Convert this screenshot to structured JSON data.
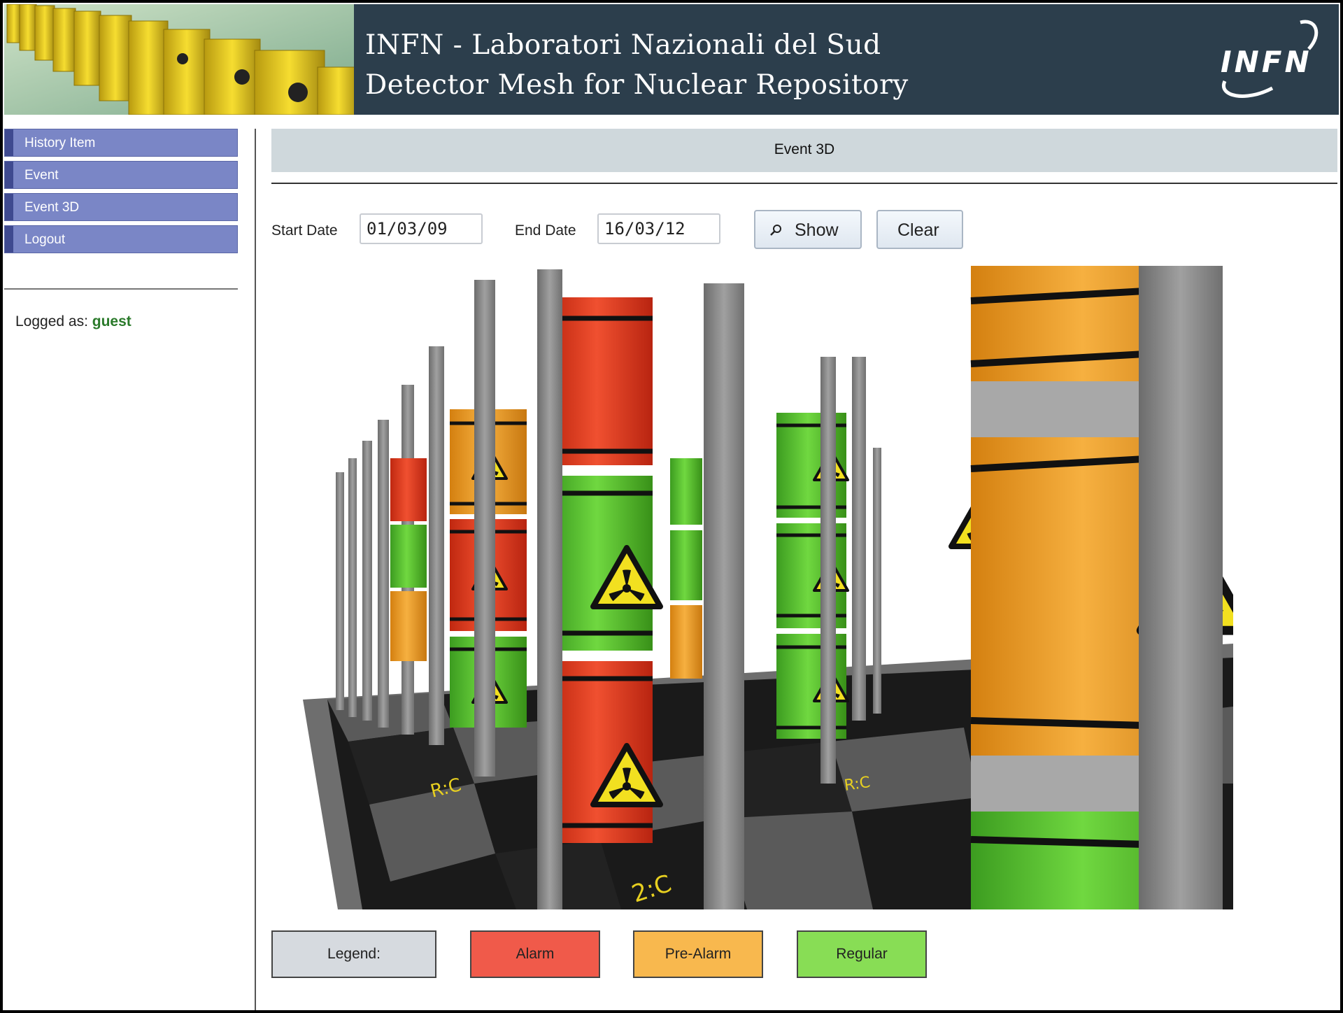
{
  "header": {
    "title_line1": "INFN - Laboratori Nazionali del Sud",
    "title_line2": "Detector Mesh for Nuclear Repository",
    "logo_text": "INFN"
  },
  "sidebar": {
    "items": [
      {
        "label": "History Item"
      },
      {
        "label": "Event"
      },
      {
        "label": "Event 3D"
      },
      {
        "label": "Logout"
      }
    ],
    "logged_label": "Logged as:",
    "logged_user": "guest"
  },
  "main": {
    "panel_title": "Event 3D",
    "start_date_label": "Start Date",
    "start_date_value": "01/03/09",
    "end_date_label": "End Date",
    "end_date_value": "16/03/12",
    "show_label": "Show",
    "clear_label": "Clear",
    "scene_labels": [
      "R:C",
      "R:C",
      "2:C"
    ]
  },
  "legend": {
    "title": "Legend:",
    "items": [
      {
        "label": "Alarm",
        "color": "#f05a4a"
      },
      {
        "label": "Pre-Alarm",
        "color": "#f8b84e"
      },
      {
        "label": "Regular",
        "color": "#88dd55"
      }
    ]
  },
  "colors": {
    "header_bg": "#2c3e4c",
    "sidebar_btn": "#7a86c6",
    "title_bar": "#cfd8dc",
    "barrel_red": "#e8402a",
    "barrel_orange": "#f0a020",
    "barrel_green": "#5cc430",
    "pole_gray": "#8a8a8a"
  },
  "icons": {
    "show_icon": "search-icon",
    "barrel_symbol": "radiation-trefoil-icon"
  }
}
